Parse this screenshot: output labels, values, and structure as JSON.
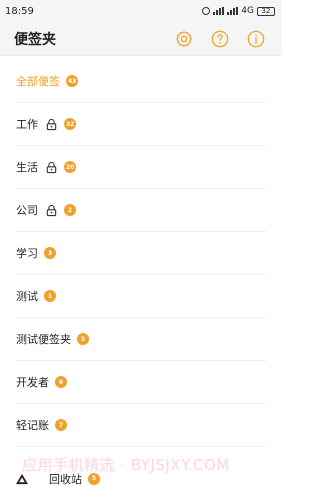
{
  "status_bar": {
    "time": "18:59",
    "network": "4G",
    "battery": "32"
  },
  "header": {
    "title": "便签夹"
  },
  "folders": [
    {
      "label": "全部便签",
      "count": "43",
      "locked": false,
      "active": true
    },
    {
      "label": "工作",
      "count": "32",
      "locked": true,
      "active": false
    },
    {
      "label": "生活",
      "count": "20",
      "locked": true,
      "active": false
    },
    {
      "label": "公司",
      "count": "2",
      "locked": true,
      "active": false
    },
    {
      "label": "学习",
      "count": "3",
      "locked": false,
      "active": false
    },
    {
      "label": "测试",
      "count": "1",
      "locked": false,
      "active": false
    },
    {
      "label": "测试便签夹",
      "count": "5",
      "locked": false,
      "active": false
    },
    {
      "label": "开发者",
      "count": "6",
      "locked": false,
      "active": false
    },
    {
      "label": "轻记账",
      "count": "7",
      "locked": false,
      "active": false
    }
  ],
  "trash": {
    "label": "回收站",
    "count": "5"
  },
  "watermark": "应用手机精选 · BYJSJXY.COM",
  "colors": {
    "accent": "#f0a12c",
    "text": "#222222",
    "divider": "#eeeeee"
  }
}
